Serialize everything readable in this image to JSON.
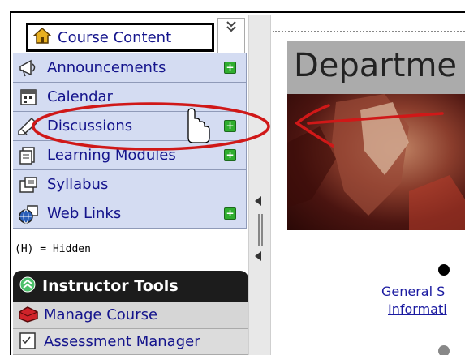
{
  "sidebar": {
    "course_content": "Course Content",
    "items": [
      {
        "label": "Announcements",
        "icon": "megaphone-icon",
        "addable": true
      },
      {
        "label": "Calendar",
        "icon": "calendar-icon",
        "addable": false
      },
      {
        "label": "Discussions",
        "icon": "discussion-icon",
        "addable": true
      },
      {
        "label": "Learning Modules",
        "icon": "modules-icon",
        "addable": true
      },
      {
        "label": "Syllabus",
        "icon": "syllabus-icon",
        "addable": false
      },
      {
        "label": "Web Links",
        "icon": "globe-icon",
        "addable": true
      }
    ],
    "add_symbol": "+",
    "hidden_note": "(H) = Hidden"
  },
  "instructor_tools": {
    "title": "Instructor Tools",
    "items": [
      {
        "label": "Manage Course",
        "icon": "toolbox-icon"
      },
      {
        "label": "Assessment Manager",
        "icon": "assessment-icon"
      }
    ]
  },
  "content": {
    "banner": "Departme",
    "links": [
      "General S",
      "Informati"
    ]
  },
  "colors": {
    "nav_bg": "#d4dcf2",
    "nav_text": "#14148c",
    "add_green": "#2fae2f",
    "annotation_red": "#d01818",
    "instructor_header": "#1c1c1c"
  }
}
